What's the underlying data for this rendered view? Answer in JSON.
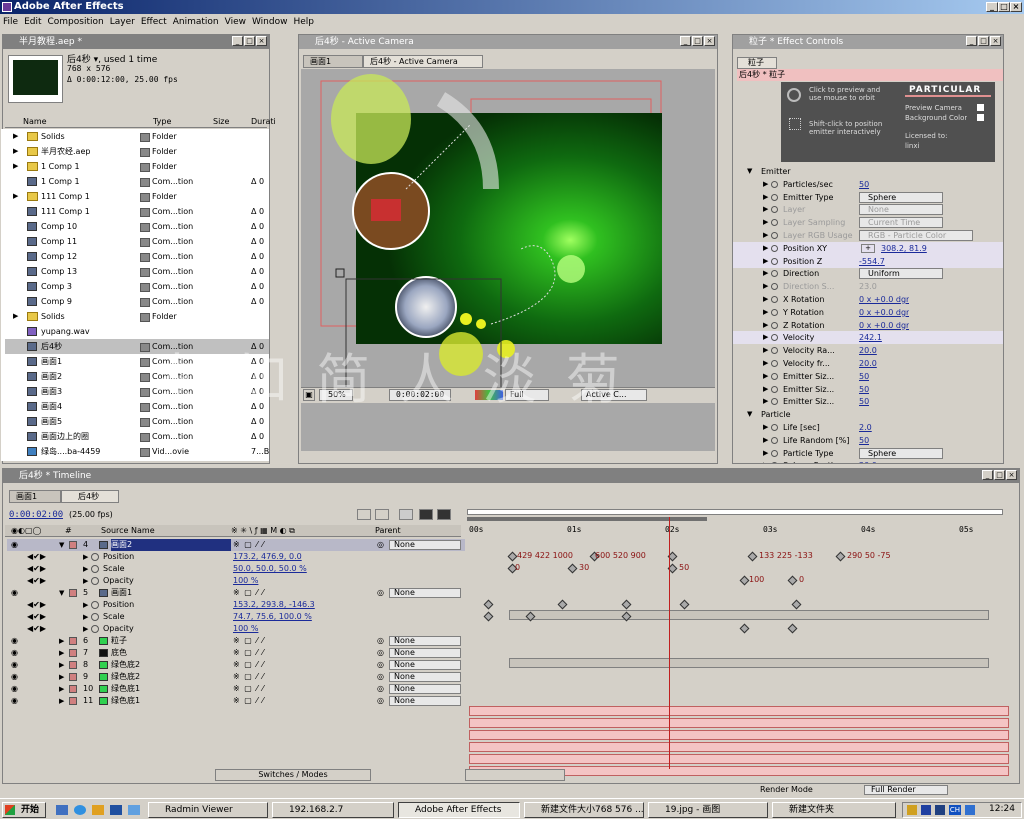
{
  "app": {
    "title": "Adobe After Effects"
  },
  "menu": [
    "File",
    "Edit",
    "Composition",
    "Layer",
    "Effect",
    "Animation",
    "View",
    "Window",
    "Help"
  ],
  "project": {
    "title": "半月教程.aep *",
    "comp_name": "后4秒",
    "comp_info1": "后4秒 ▾, used 1 time",
    "comp_info2": "768 x 576",
    "comp_info3": "Δ 0:00:12:00, 25.00 fps",
    "headers": {
      "name": "Name",
      "type": "Type",
      "size": "Size",
      "dur": "Durati"
    },
    "items": [
      {
        "name": "Solids",
        "type": "Folder",
        "dur": "",
        "kind": "folder"
      },
      {
        "name": "半月农经.aep",
        "type": "Folder",
        "dur": "",
        "kind": "folder"
      },
      {
        "name": "1 Comp 1",
        "type": "Folder",
        "dur": "",
        "kind": "folder"
      },
      {
        "name": "1 Comp 1",
        "type": "Com...tion",
        "dur": "Δ 0",
        "kind": "comp"
      },
      {
        "name": "111 Comp 1",
        "type": "Folder",
        "dur": "",
        "kind": "folder"
      },
      {
        "name": "111 Comp 1",
        "type": "Com...tion",
        "dur": "Δ 0",
        "kind": "comp"
      },
      {
        "name": "Comp 10",
        "type": "Com...tion",
        "dur": "Δ 0",
        "kind": "comp"
      },
      {
        "name": "Comp 11",
        "type": "Com...tion",
        "dur": "Δ 0",
        "kind": "comp"
      },
      {
        "name": "Comp 12",
        "type": "Com...tion",
        "dur": "Δ 0",
        "kind": "comp"
      },
      {
        "name": "Comp 13",
        "type": "Com...tion",
        "dur": "Δ 0",
        "kind": "comp"
      },
      {
        "name": "Comp 3",
        "type": "Com...tion",
        "dur": "Δ 0",
        "kind": "comp"
      },
      {
        "name": "Comp 9",
        "type": "Com...tion",
        "dur": "Δ 0",
        "kind": "comp"
      },
      {
        "name": "Solids",
        "type": "Folder",
        "dur": "",
        "kind": "folder"
      },
      {
        "name": "yupang.wav",
        "type": "",
        "dur": "",
        "kind": "audio"
      },
      {
        "name": "后4秒",
        "type": "Com...tion",
        "dur": "Δ 0",
        "kind": "comp"
      },
      {
        "name": "画面1",
        "type": "Com...tion",
        "dur": "Δ 0",
        "kind": "comp"
      },
      {
        "name": "画面2",
        "type": "Com...tion",
        "dur": "Δ 0",
        "kind": "comp"
      },
      {
        "name": "画面3",
        "type": "Com...tion",
        "dur": "Δ 0",
        "kind": "comp"
      },
      {
        "name": "画面4",
        "type": "Com...tion",
        "dur": "Δ 0",
        "kind": "comp"
      },
      {
        "name": "画面5",
        "type": "Com...tion",
        "dur": "Δ 0",
        "kind": "comp"
      },
      {
        "name": "画面边上的圈",
        "type": "Com...tion",
        "dur": "Δ 0",
        "kind": "comp"
      },
      {
        "name": "绿岛....ba-4459",
        "type": "Vid...ovie",
        "dur": "7...B",
        "kind": "video"
      }
    ]
  },
  "comp": {
    "title": "后4秒 - Active Camera",
    "tab1": "画面1",
    "tab2": "后4秒 - Active Camera",
    "zoom": "50%",
    "time": "0:00:02:00",
    "res": "Full",
    "camera": "Active C..."
  },
  "effects": {
    "title": "粒子 * Effect Controls",
    "tab": "粒子",
    "subtitle": "后4秒 * 粒子",
    "hint1": "Click to preview and",
    "hint2": "use mouse to orbit",
    "hint3": "Shift-click to position",
    "hint4": "emitter interactively",
    "logo": "PARTICULAR",
    "prev_cam": "Preview Camera",
    "bg_color": "Background Color",
    "licensed": "Licensed to:",
    "licensee": "linxi",
    "rows": [
      {
        "label": "Emitter",
        "value": "",
        "type": "section"
      },
      {
        "label": "Particles/sec",
        "value": "50",
        "type": "val"
      },
      {
        "label": "Emitter Type",
        "value": "Sphere",
        "type": "dd"
      },
      {
        "label": "Layer",
        "value": "None",
        "type": "dd-dis"
      },
      {
        "label": "Layer Sampling",
        "value": "Current Time",
        "type": "dd-dis"
      },
      {
        "label": "Layer RGB Usage",
        "value": "RGB - Particle Color",
        "type": "dd-dis"
      },
      {
        "label": "Position XY",
        "value": "308.2, 81.9",
        "type": "val"
      },
      {
        "label": "Position Z",
        "value": "-554.7",
        "type": "val"
      },
      {
        "label": "Direction",
        "value": "Uniform",
        "type": "dd"
      },
      {
        "label": "Direction S...",
        "value": "23.0",
        "type": "dis"
      },
      {
        "label": "X Rotation",
        "value": "0 x +0.0 dgr",
        "type": "val"
      },
      {
        "label": "Y Rotation",
        "value": "0 x +0.0 dgr",
        "type": "val"
      },
      {
        "label": "Z Rotation",
        "value": "0 x +0.0 dgr",
        "type": "val"
      },
      {
        "label": "Velocity",
        "value": "242.1",
        "type": "val"
      },
      {
        "label": "Velocity Ra...",
        "value": "20.0",
        "type": "val"
      },
      {
        "label": "Velocity fr...",
        "value": "20.0",
        "type": "val"
      },
      {
        "label": "Emitter Siz...",
        "value": "50",
        "type": "val"
      },
      {
        "label": "Emitter Siz...",
        "value": "50",
        "type": "val"
      },
      {
        "label": "Emitter Siz...",
        "value": "50",
        "type": "val"
      },
      {
        "label": "Particle",
        "value": "",
        "type": "section"
      },
      {
        "label": "Life [sec]",
        "value": "2.0",
        "type": "val"
      },
      {
        "label": "Life Random [%]",
        "value": "50",
        "type": "val"
      },
      {
        "label": "Particle Type",
        "value": "Sphere",
        "type": "dd"
      },
      {
        "label": "Sphere Feather",
        "value": "20.0",
        "type": "val"
      }
    ],
    "render_mode": "Render Mode",
    "render_val": "Full Render"
  },
  "timeline": {
    "title": "后4秒 * Timeline",
    "tab1": "画面1",
    "tab2": "后4秒",
    "time": "0:00:02:00",
    "fps": "(25.00 fps)",
    "col_source": "Source Name",
    "col_parent": "Parent",
    "switches": "Switches / Modes",
    "ruler": [
      "00s",
      "01s",
      "02s",
      "03s",
      "04s",
      "05s"
    ],
    "layers": [
      {
        "num": "4",
        "name": "画面2",
        "parent": "None",
        "kind": "layer",
        "sel": true
      },
      {
        "num": "",
        "name": "Position",
        "value": "173.2, 476.9, 0.0",
        "kind": "prop"
      },
      {
        "num": "",
        "name": "Scale",
        "value": "50.0, 50.0, 50.0 %",
        "kind": "prop"
      },
      {
        "num": "",
        "name": "Opacity",
        "value": "100 %",
        "kind": "prop"
      },
      {
        "num": "5",
        "name": "画面1",
        "parent": "None",
        "kind": "layer"
      },
      {
        "num": "",
        "name": "Position",
        "value": "153.2, 293.8, -146.3",
        "kind": "prop"
      },
      {
        "num": "",
        "name": "Scale",
        "value": "74.7, 75.6, 100.0 %",
        "kind": "prop"
      },
      {
        "num": "",
        "name": "Opacity",
        "value": "100 %",
        "kind": "prop"
      },
      {
        "num": "6",
        "name": "粒子",
        "parent": "None",
        "kind": "layer"
      },
      {
        "num": "7",
        "name": "底色",
        "parent": "None",
        "kind": "layer"
      },
      {
        "num": "8",
        "name": "绿色底2",
        "parent": "None",
        "kind": "layer"
      },
      {
        "num": "9",
        "name": "绿色底2",
        "parent": "None",
        "kind": "layer"
      },
      {
        "num": "10",
        "name": "绿色底1",
        "parent": "None",
        "kind": "layer"
      },
      {
        "num": "11",
        "name": "绿色底1",
        "parent": "None",
        "kind": "layer"
      }
    ],
    "kv_pos": [
      "429 422 1000",
      "600 520 900",
      "133 225 -133",
      "290 50 -75"
    ],
    "kv_scale": [
      "0",
      "30",
      "50"
    ],
    "kv_op": [
      "100",
      "0"
    ]
  },
  "watermark": "素 如 简  人 淡 菊",
  "taskbar": {
    "start": "开始",
    "items": [
      "Radmin Viewer",
      "192.168.2.7",
      "Adobe After Effects",
      "新建文件大小768 576 ...",
      "19.jpg - 画图",
      "新建文件夹"
    ],
    "clock": "12:24"
  }
}
